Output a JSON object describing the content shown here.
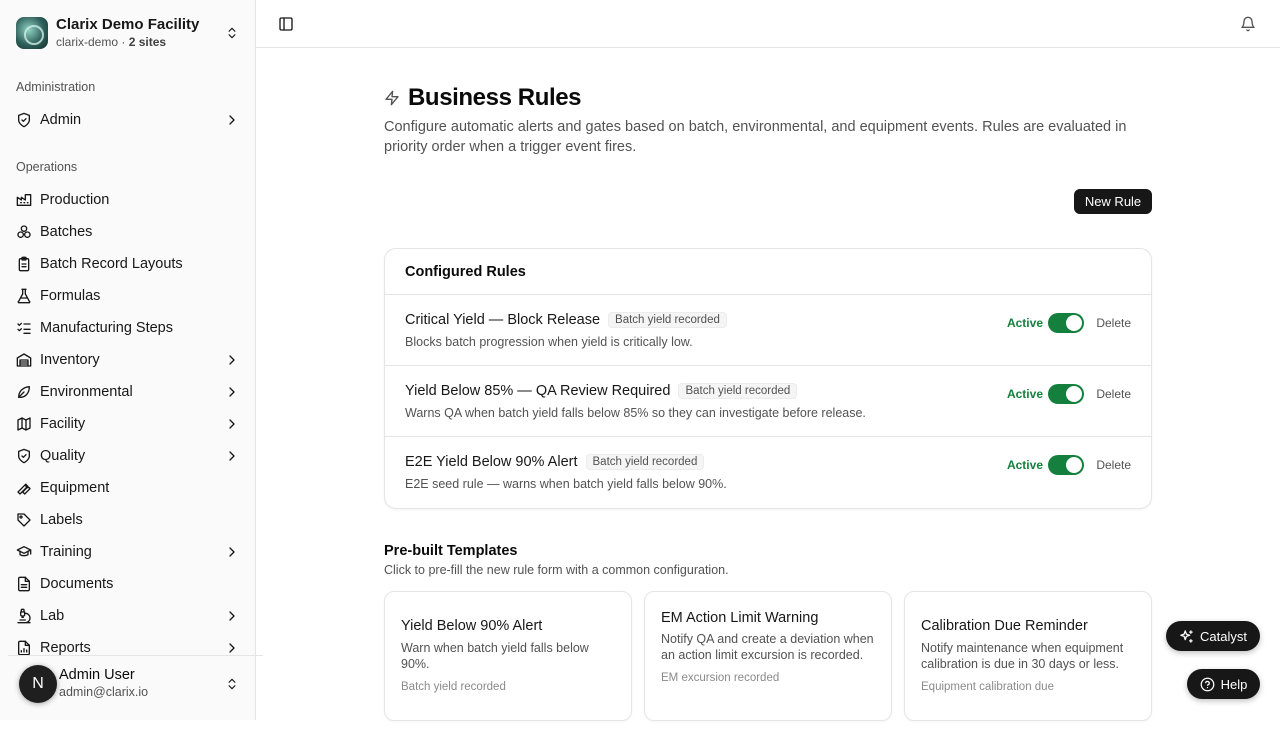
{
  "org": {
    "name": "Clarix Demo Facility",
    "slug": "clarix-demo",
    "separator": " · ",
    "sites": "2 sites"
  },
  "sidebar": {
    "admin_group": "Administration",
    "admin_item": "Admin",
    "ops_group": "Operations",
    "items": [
      {
        "label": "Production",
        "icon": "factory-icon"
      },
      {
        "label": "Batches",
        "icon": "boxes-icon"
      },
      {
        "label": "Batch Record Layouts",
        "icon": "clipboard-icon"
      },
      {
        "label": "Formulas",
        "icon": "flask-icon"
      },
      {
        "label": "Manufacturing Steps",
        "icon": "list-checks-icon"
      },
      {
        "label": "Inventory",
        "icon": "warehouse-icon"
      },
      {
        "label": "Environmental",
        "icon": "leaf-icon"
      },
      {
        "label": "Facility",
        "icon": "map-icon"
      },
      {
        "label": "Quality",
        "icon": "shield-check-icon"
      },
      {
        "label": "Equipment",
        "icon": "wrench-icon"
      },
      {
        "label": "Labels",
        "icon": "tag-icon"
      },
      {
        "label": "Training",
        "icon": "graduation-cap-icon"
      },
      {
        "label": "Documents",
        "icon": "file-text-icon"
      },
      {
        "label": "Lab",
        "icon": "microscope-icon"
      },
      {
        "label": "Reports",
        "icon": "file-chart-icon"
      }
    ]
  },
  "user": {
    "initial": "N",
    "name": "Admin User",
    "email": "admin@clarix.io"
  },
  "page": {
    "title": "Business Rules",
    "description": "Configure automatic alerts and gates based on batch, environmental, and equipment events. Rules are evaluated in priority order when a trigger event fires.",
    "new_rule_label": "New Rule"
  },
  "configured": {
    "title": "Configured Rules",
    "rules": [
      {
        "name": "Critical Yield — Block Release",
        "trigger": "Batch yield recorded",
        "description": "Blocks batch progression when yield is critically low.",
        "status": "Active",
        "delete_label": "Delete"
      },
      {
        "name": "Yield Below 85% — QA Review Required",
        "trigger": "Batch yield recorded",
        "description": "Warns QA when batch yield falls below 85% so they can investigate before release.",
        "status": "Active",
        "delete_label": "Delete"
      },
      {
        "name": "E2E Yield Below 90% Alert",
        "trigger": "Batch yield recorded",
        "description": "E2E seed rule — warns when batch yield falls below 90%.",
        "status": "Active",
        "delete_label": "Delete"
      }
    ]
  },
  "templates": {
    "title": "Pre-built Templates",
    "description": "Click to pre-fill the new rule form with a common configuration.",
    "items": [
      {
        "name": "Yield Below 90% Alert",
        "description": "Warn when batch yield falls below 90%.",
        "trigger": "Batch yield recorded"
      },
      {
        "name": "EM Action Limit Warning",
        "description": "Notify QA and create a deviation when an action limit excursion is recorded.",
        "trigger": "EM excursion recorded"
      },
      {
        "name": "Calibration Due Reminder",
        "description": "Notify maintenance when equipment calibration is due in 30 days or less.",
        "trigger": "Equipment calibration due"
      }
    ]
  },
  "floating": {
    "catalyst_label": "Catalyst",
    "help_label": "Help"
  },
  "colors": {
    "active_green": "#15803d",
    "primary_dark": "#171717"
  }
}
